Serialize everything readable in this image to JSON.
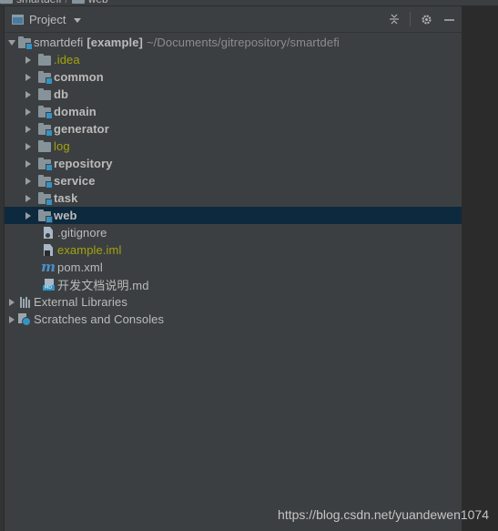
{
  "breadcrumb": {
    "items": [
      "smartdefi",
      "web"
    ]
  },
  "panel": {
    "view_label": "Project",
    "tools": [
      "collapse-icon",
      "gear-icon",
      "minimize-icon"
    ]
  },
  "tree": {
    "root": {
      "name": "smartdefi",
      "module": "[example]",
      "path": "~/Documents/gitrepository/smartdefi"
    },
    "folders": [
      {
        "label": ".idea",
        "style": "excluded"
      },
      {
        "label": "common",
        "style": "module"
      },
      {
        "label": "db",
        "style": "plain"
      },
      {
        "label": "domain",
        "style": "module"
      },
      {
        "label": "generator",
        "style": "module"
      },
      {
        "label": "log",
        "style": "excluded"
      },
      {
        "label": "repository",
        "style": "module"
      },
      {
        "label": "service",
        "style": "module"
      },
      {
        "label": "task",
        "style": "module"
      },
      {
        "label": "web",
        "style": "module",
        "selected": true
      }
    ],
    "files": [
      {
        "label": ".gitignore",
        "icon": "gitignore-file-icon"
      },
      {
        "label": "example.iml",
        "icon": "iml-file-icon"
      },
      {
        "label": "pom.xml",
        "icon": "maven-icon"
      },
      {
        "label": "开发文档说明.md",
        "icon": "markdown-file-icon"
      }
    ],
    "external_libraries": "External Libraries",
    "scratches": "Scratches and Consoles"
  },
  "watermark": "https://blog.csdn.net/yuandewen1074",
  "colors": {
    "background": "#3c3f41",
    "selection": "#0d293e",
    "excluded_text": "#a3a30f",
    "module_badge": "#3592c4"
  }
}
